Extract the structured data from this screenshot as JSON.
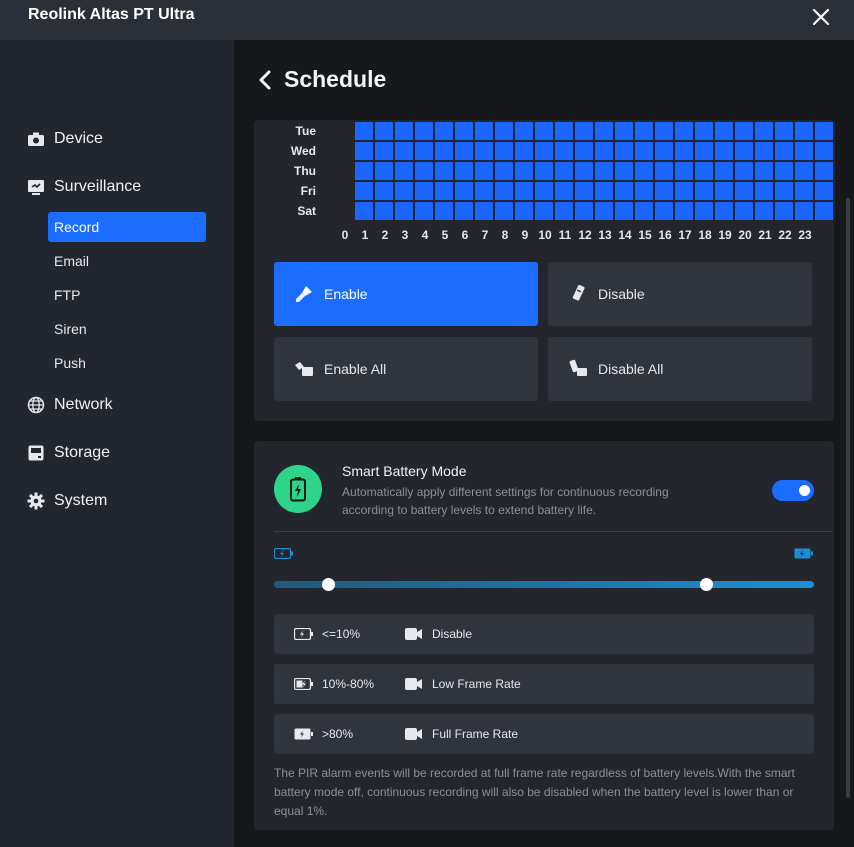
{
  "window": {
    "title": "Reolink Altas PT Ultra"
  },
  "sidebar": {
    "items": [
      {
        "label": "Device",
        "icon": "camera-icon"
      },
      {
        "label": "Surveillance",
        "icon": "surveillance-icon"
      },
      {
        "label": "Network",
        "icon": "globe-icon"
      },
      {
        "label": "Storage",
        "icon": "storage-icon"
      },
      {
        "label": "System",
        "icon": "gear-icon"
      }
    ],
    "subitems": [
      {
        "label": "Record",
        "active": true
      },
      {
        "label": "Email"
      },
      {
        "label": "FTP"
      },
      {
        "label": "Siren"
      },
      {
        "label": "Push"
      }
    ]
  },
  "page": {
    "title": "Schedule"
  },
  "schedule": {
    "days": [
      "Tue",
      "Wed",
      "Thu",
      "Fri",
      "Sat"
    ],
    "hours": [
      "0",
      "1",
      "2",
      "3",
      "4",
      "5",
      "6",
      "7",
      "8",
      "9",
      "10",
      "11",
      "12",
      "13",
      "14",
      "15",
      "16",
      "17",
      "18",
      "19",
      "20",
      "21",
      "22",
      "23"
    ],
    "cell_color": "#1a66ff",
    "buttons": {
      "enable": "Enable",
      "disable": "Disable",
      "enable_all": "Enable All",
      "disable_all": "Disable All"
    }
  },
  "smart_battery": {
    "title": "Smart Battery Mode",
    "description": "Automatically apply different settings for continuous recording according to battery levels to extend battery life.",
    "enabled": true,
    "slider": {
      "low": 10,
      "high": 80
    },
    "levels": [
      {
        "range": "<=10%",
        "mode": "Disable"
      },
      {
        "range": "10%-80%",
        "mode": "Low Frame Rate"
      },
      {
        "range": ">80%",
        "mode": "Full Frame Rate"
      }
    ],
    "footnote": "The PIR alarm events will be recorded at full frame rate regardless of battery levels.With the smart battery mode off, continuous recording will also be disabled when the battery level is lower than or equal 1%."
  },
  "colors": {
    "accent": "#1a6dff",
    "battery_green": "#2ed48a"
  }
}
